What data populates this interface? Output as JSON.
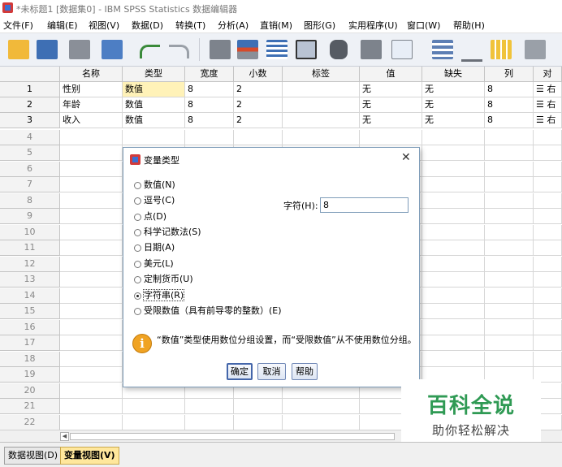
{
  "window": {
    "title": "*未标题1 [数据集0] - IBM SPSS Statistics 数据编辑器"
  },
  "menu": [
    "文件(F)",
    "编辑(E)",
    "视图(V)",
    "数据(D)",
    "转换(T)",
    "分析(A)",
    "直销(M)",
    "图形(G)",
    "实用程序(U)",
    "窗口(W)",
    "帮助(H)"
  ],
  "toolbar": [
    "open-folder-icon",
    "save-icon",
    "print-icon",
    "dialog-recall-icon",
    "undo-icon",
    "redo-icon",
    "goto-case-icon",
    "goto-variable-icon",
    "variables-icon",
    "run-descriptives-icon",
    "find-icon",
    "insert-cases-icon",
    "insert-variable-icon",
    "split-file-icon",
    "weight-cases-icon",
    "select-cases-icon",
    "value-labels-icon"
  ],
  "grid": {
    "columns": [
      "名称",
      "类型",
      "宽度",
      "小数",
      "标签",
      "值",
      "缺失",
      "列",
      "对"
    ],
    "rows": [
      [
        "性别",
        "数值",
        "8",
        "2",
        "",
        "无",
        "无",
        "8",
        "右"
      ],
      [
        "年龄",
        "数值",
        "8",
        "2",
        "",
        "无",
        "无",
        "8",
        "右"
      ],
      [
        "收入",
        "数值",
        "8",
        "2",
        "",
        "无",
        "无",
        "8",
        "右"
      ]
    ],
    "row_numbers": [
      "1",
      "2",
      "3",
      "4",
      "5",
      "6",
      "7",
      "8",
      "9",
      "10",
      "11",
      "12",
      "13",
      "14",
      "15",
      "16",
      "17",
      "18",
      "19",
      "20",
      "21",
      "22"
    ]
  },
  "dialog": {
    "title": "变量类型",
    "options": [
      "数值(N)",
      "逗号(C)",
      "点(D)",
      "科学记数法(S)",
      "日期(A)",
      "美元(L)",
      "定制货币(U)",
      "字符串(R)",
      "受限数值（具有前导零的整数）(E)"
    ],
    "selected": "字符串(R)",
    "string_label": "字符(H):",
    "string_value": "8",
    "note": "“数值”类型使用数位分组设置，而“受限数值”从不使用数位分组。",
    "buttons": {
      "ok": "确定",
      "cancel": "取消",
      "help": "帮助"
    }
  },
  "tabs": [
    "数据视图(D)",
    "变量视图(V)"
  ],
  "active_tab": "变量视图(V)",
  "watermark": {
    "line1": "百科全说",
    "line2": "助你轻松解决"
  },
  "colors": {
    "selected_cell": "#fff2b8",
    "active_tab": "#ffe79c",
    "watermark": "#2f9a54"
  }
}
